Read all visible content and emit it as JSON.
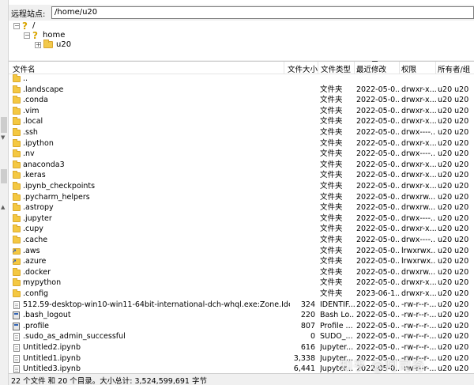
{
  "path_bar": {
    "label": "远程站点:",
    "value": "/home/u20"
  },
  "tree": [
    {
      "label": "/",
      "icon": "question-icon",
      "expander": "−"
    },
    {
      "label": "home",
      "icon": "question-icon",
      "expander": "−"
    },
    {
      "label": "u20",
      "icon": "folder-icon",
      "expander": "+"
    }
  ],
  "columns": {
    "name": "文件名",
    "size": "文件大小",
    "type": "文件类型",
    "date": "最近修改",
    "perm": "权限",
    "owner": "所有者/组"
  },
  "files": [
    {
      "name": "..",
      "size": "",
      "type": "",
      "date": "",
      "perm": "",
      "owner": "",
      "icon": "folder"
    },
    {
      "name": ".landscape",
      "size": "",
      "type": "文件夹",
      "date": "2022-05-0...",
      "perm": "drwxr-x...",
      "owner": "u20 u20",
      "icon": "folder"
    },
    {
      "name": ".conda",
      "size": "",
      "type": "文件夹",
      "date": "2022-05-0...",
      "perm": "drwxr-x...",
      "owner": "u20 u20",
      "icon": "folder"
    },
    {
      "name": ".vim",
      "size": "",
      "type": "文件夹",
      "date": "2022-05-0...",
      "perm": "drwxr-x...",
      "owner": "u20 u20",
      "icon": "folder"
    },
    {
      "name": ".local",
      "size": "",
      "type": "文件夹",
      "date": "2022-05-0...",
      "perm": "drwxr-x...",
      "owner": "u20 u20",
      "icon": "folder"
    },
    {
      "name": ".ssh",
      "size": "",
      "type": "文件夹",
      "date": "2022-05-0...",
      "perm": "drwx----...",
      "owner": "u20 u20",
      "icon": "folder"
    },
    {
      "name": ".ipython",
      "size": "",
      "type": "文件夹",
      "date": "2022-05-0...",
      "perm": "drwxr-x...",
      "owner": "u20 u20",
      "icon": "folder"
    },
    {
      "name": ".nv",
      "size": "",
      "type": "文件夹",
      "date": "2022-05-0...",
      "perm": "drwx----...",
      "owner": "u20 u20",
      "icon": "folder"
    },
    {
      "name": "anaconda3",
      "size": "",
      "type": "文件夹",
      "date": "2022-05-0...",
      "perm": "drwxr-x...",
      "owner": "u20 u20",
      "icon": "folder"
    },
    {
      "name": ".keras",
      "size": "",
      "type": "文件夹",
      "date": "2022-05-0...",
      "perm": "drwxr-x...",
      "owner": "u20 u20",
      "icon": "folder"
    },
    {
      "name": ".ipynb_checkpoints",
      "size": "",
      "type": "文件夹",
      "date": "2022-05-0...",
      "perm": "drwxr-x...",
      "owner": "u20 u20",
      "icon": "folder"
    },
    {
      "name": ".pycharm_helpers",
      "size": "",
      "type": "文件夹",
      "date": "2022-05-0...",
      "perm": "drwxrw...",
      "owner": "u20 u20",
      "icon": "folder"
    },
    {
      "name": ".astropy",
      "size": "",
      "type": "文件夹",
      "date": "2022-05-0...",
      "perm": "drwxrw...",
      "owner": "u20 u20",
      "icon": "folder"
    },
    {
      "name": ".jupyter",
      "size": "",
      "type": "文件夹",
      "date": "2022-05-0...",
      "perm": "drwx----...",
      "owner": "u20 u20",
      "icon": "folder"
    },
    {
      "name": ".cupy",
      "size": "",
      "type": "文件夹",
      "date": "2022-05-0...",
      "perm": "drwxr-x...",
      "owner": "u20 u20",
      "icon": "folder"
    },
    {
      "name": ".cache",
      "size": "",
      "type": "文件夹",
      "date": "2022-05-0...",
      "perm": "drwx----...",
      "owner": "u20 u20",
      "icon": "folder"
    },
    {
      "name": ".aws",
      "size": "",
      "type": "文件夹",
      "date": "2022-05-0...",
      "perm": "lrwxrwx...",
      "owner": "u20 u20",
      "icon": "link"
    },
    {
      "name": ".azure",
      "size": "",
      "type": "文件夹",
      "date": "2022-05-0...",
      "perm": "lrwxrwx...",
      "owner": "u20 u20",
      "icon": "link"
    },
    {
      "name": ".docker",
      "size": "",
      "type": "文件夹",
      "date": "2022-05-0...",
      "perm": "drwxrw...",
      "owner": "u20 u20",
      "icon": "folder"
    },
    {
      "name": "mypython",
      "size": "",
      "type": "文件夹",
      "date": "2022-05-0...",
      "perm": "drwxr-x...",
      "owner": "u20 u20",
      "icon": "folder"
    },
    {
      "name": ".config",
      "size": "",
      "type": "文件夹",
      "date": "2023-06-1...",
      "perm": "drwxr-x...",
      "owner": "u20 u20",
      "icon": "folder"
    },
    {
      "name": "512.59-desktop-win10-win11-64bit-international-dch-whql.exe:Zone.Identifier",
      "size": "324",
      "type": "IDENTIF...",
      "date": "2022-05-0...",
      "perm": "-rw-r--r-...",
      "owner": "u20 u20",
      "icon": "file"
    },
    {
      "name": ".bash_logout",
      "size": "220",
      "type": "Bash Lo...",
      "date": "2022-05-0...",
      "perm": "-rw-r--r-...",
      "owner": "u20 u20",
      "icon": "exe"
    },
    {
      "name": ".profile",
      "size": "807",
      "type": "Profile ...",
      "date": "2022-05-0...",
      "perm": "-rw-r--r-...",
      "owner": "u20 u20",
      "icon": "exe"
    },
    {
      "name": ".sudo_as_admin_successful",
      "size": "0",
      "type": "SUDO_...",
      "date": "2022-05-0...",
      "perm": "-rw-r--r-...",
      "owner": "u20 u20",
      "icon": "file"
    },
    {
      "name": "Untitled2.ipynb",
      "size": "616",
      "type": "Jupyter...",
      "date": "2022-05-0...",
      "perm": "-rw-r--r-...",
      "owner": "u20 u20",
      "icon": "file"
    },
    {
      "name": "Untitled1.ipynb",
      "size": "3,338",
      "type": "Jupyter...",
      "date": "2022-05-0...",
      "perm": "-rw-r--r-...",
      "owner": "u20 u20",
      "icon": "file"
    },
    {
      "name": "Untitled3.ipynb",
      "size": "6,441",
      "type": "Jupyter...",
      "date": "2022-05-0...",
      "perm": "-rw-r--r-...",
      "owner": "u20 u20",
      "icon": "file"
    }
  ],
  "status": "22 个文件 和 20 个目录。大小总计: 3,524,599,691 字节",
  "watermark": "知乎 @阿司奇"
}
